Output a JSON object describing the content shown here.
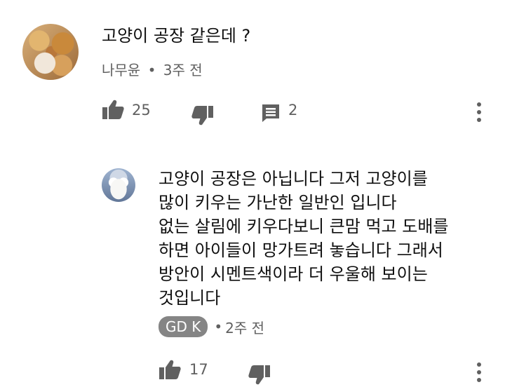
{
  "comment": {
    "text": "고양이 공장 같은데 ?",
    "author": "나무윤",
    "time": "3주 전",
    "likes": "25",
    "replies": "2"
  },
  "reply": {
    "text_lines": [
      "고양이 공장은 아닙니다 그저 고양이를",
      "많이 키우는 가난한 일반인 입니다",
      "없는 살림에 키우다보니 큰맘 먹고 도배를",
      "하면 아이들이 망가트려 놓습니다 그래서",
      "방안이 시멘트색이라 더 우울해 보이는",
      "것입니다"
    ],
    "author": "GD K",
    "time": "2주 전",
    "likes": "17"
  },
  "separator": "•",
  "icons": {
    "like": "thumb-up-icon",
    "dislike": "thumb-down-icon",
    "reply": "comment-icon",
    "more": "more-vert-icon"
  },
  "colors": {
    "text": "#0f0f0f",
    "meta": "#606060",
    "icon": "#606060",
    "author_chip": "#858585"
  }
}
